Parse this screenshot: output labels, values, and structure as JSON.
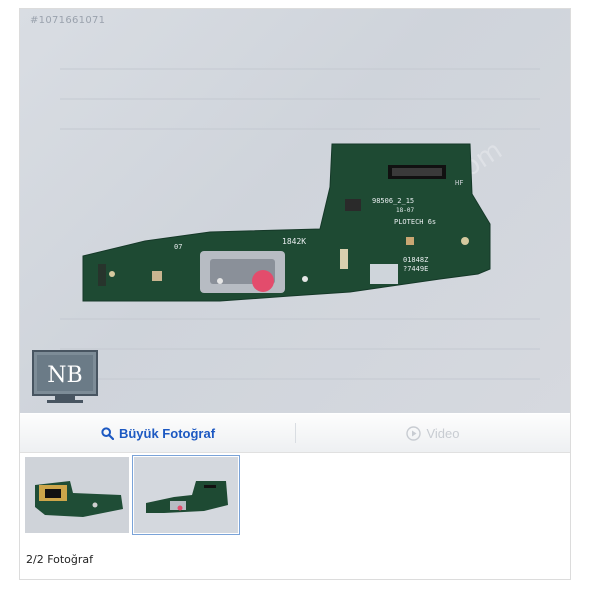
{
  "photo": {
    "id_label": "#1071661071",
    "watermark": "sahibinden.com",
    "logo_text": "NB",
    "pcb_texts": {
      "label_07": "07",
      "label_1842k": "1842K",
      "label_98506": "98506_2_15",
      "label_date": "18-07",
      "label_plotech": "PLOTECH 6s",
      "label_hf": "HF",
      "label_serial1": "01848Z",
      "label_serial2": "?7449E"
    }
  },
  "toolbar": {
    "photo_label": "Büyük Fotoğraf",
    "video_label": "Video"
  },
  "thumbnails": [
    {
      "alt": "thumbnail-1"
    },
    {
      "alt": "thumbnail-2"
    }
  ],
  "counter": "2/2 Fotoğraf",
  "colors": {
    "accent": "#1c58c2",
    "pcb": "#1e4a33",
    "connector": "#e34c6c"
  }
}
